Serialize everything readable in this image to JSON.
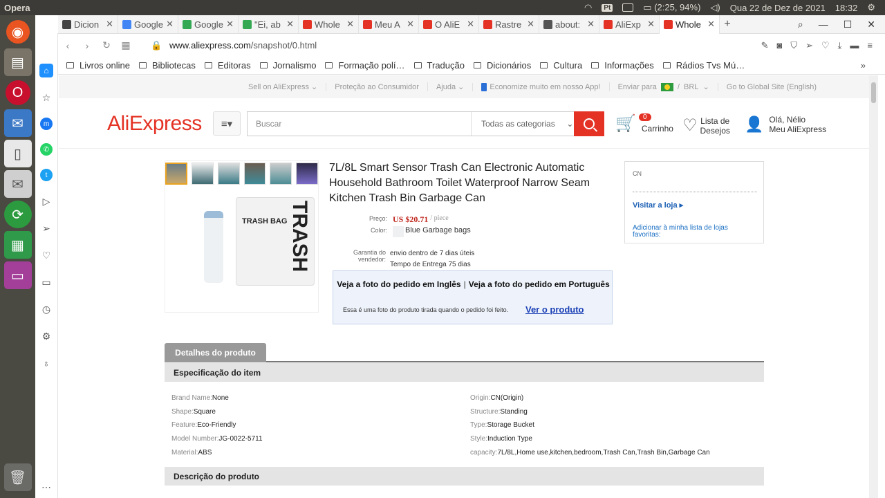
{
  "os": {
    "app_name": "Opera",
    "input_lang": "Pt",
    "battery": "(2:25, 94%)",
    "date": "Qua 22 de Dez de 2021",
    "time": "18:32"
  },
  "tabs": [
    {
      "label": "Dicion",
      "fav_color": "#444444",
      "active": false
    },
    {
      "label": "Google",
      "fav_color": "#4285f4",
      "active": false
    },
    {
      "label": "Google",
      "fav_color": "#34a853",
      "active": false
    },
    {
      "label": "\"Ei, ab",
      "fav_color": "#34a853",
      "active": false
    },
    {
      "label": "Whole",
      "fav_color": "#e43225",
      "active": false
    },
    {
      "label": "Meu A",
      "fav_color": "#e43225",
      "active": false
    },
    {
      "label": "O AliE",
      "fav_color": "#e43225",
      "active": false
    },
    {
      "label": "Rastre",
      "fav_color": "#e43225",
      "active": false
    },
    {
      "label": "about:",
      "fav_color": "#555555",
      "active": false
    },
    {
      "label": "AliExp",
      "fav_color": "#e43225",
      "active": false
    },
    {
      "label": "Whole",
      "fav_color": "#e43225",
      "active": true
    }
  ],
  "address": {
    "domain": "www.aliexpress.com",
    "path": "/snapshot/0.html"
  },
  "bookmarks": [
    "Livros online",
    "Bibliotecas",
    "Editoras",
    "Jornalismo",
    "Formação polí…",
    "Tradução",
    "Dicionários",
    "Cultura",
    "Informações",
    "Rádios Tvs Mú…"
  ],
  "topstrip": {
    "sell": "Sell on AliExpress",
    "protection": "Proteção ao Consumidor",
    "help": "Ajuda",
    "app": "Economize muito em nosso App!",
    "ship_to": "Enviar para",
    "currency": "BRL",
    "global": "Go to Global Site (English)"
  },
  "header": {
    "logo": "AliExpress",
    "search_placeholder": "Buscar",
    "category": "Todas as categorias",
    "cart_count": "0",
    "cart_label": "Carrinho",
    "wish_line1": "Lista de",
    "wish_line2": "Desejos",
    "user_line1": "Olá, Nélio",
    "user_line2": "Meu AliExpress"
  },
  "product": {
    "title": "7L/8L Smart Sensor Trash Can Electronic Automatic Household Bathroom Toilet Waterproof Narrow Seam Kitchen Trash Bin Garbage Can",
    "price_label": "Preço:",
    "price": "US $20.71",
    "per": "/ piece",
    "color_label": "Color:",
    "color_value": "Blue Garbage bags",
    "warranty_label": "Garantia do vendedor:",
    "warranty_1": "envio dentro de 7 dias úteis",
    "warranty_2": "Tempo de Entrega 75 dias",
    "image_text_small": "TRASH BAG",
    "image_text_big": "TRASH"
  },
  "snapshot": {
    "link_en": "Veja a foto do pedido em Inglês",
    "sep": "|",
    "link_pt": "Veja a foto do pedido em Português",
    "note": "Essa é uma foto do produto tirada quando o pedido foi feito.",
    "view_product": "Ver o produto"
  },
  "store": {
    "country": "CN",
    "visit": "Visitar a loja",
    "add_fav": "Adicionar à minha lista de lojas favoritas:"
  },
  "details": {
    "tab": "Detalhes do produto",
    "spec_title": "Especificação do item",
    "left": [
      {
        "k": "Brand Name:",
        "v": "None"
      },
      {
        "k": "Shape:",
        "v": "Square"
      },
      {
        "k": "Feature:",
        "v": "Eco-Friendly"
      },
      {
        "k": "Model Number:",
        "v": "JG-0022-5711"
      },
      {
        "k": "Material:",
        "v": "ABS"
      }
    ],
    "right": [
      {
        "k": "Origin:",
        "v": "CN(Origin)"
      },
      {
        "k": "Structure:",
        "v": "Standing"
      },
      {
        "k": "Type:",
        "v": "Storage Bucket"
      },
      {
        "k": "Style:",
        "v": "Induction Type"
      },
      {
        "k": "capacity:",
        "v": "7L/8L,Home use,kitchen,bedroom,Trash Can,Trash Bin,Garbage Can"
      }
    ],
    "desc_title": "Descrição do produto"
  }
}
